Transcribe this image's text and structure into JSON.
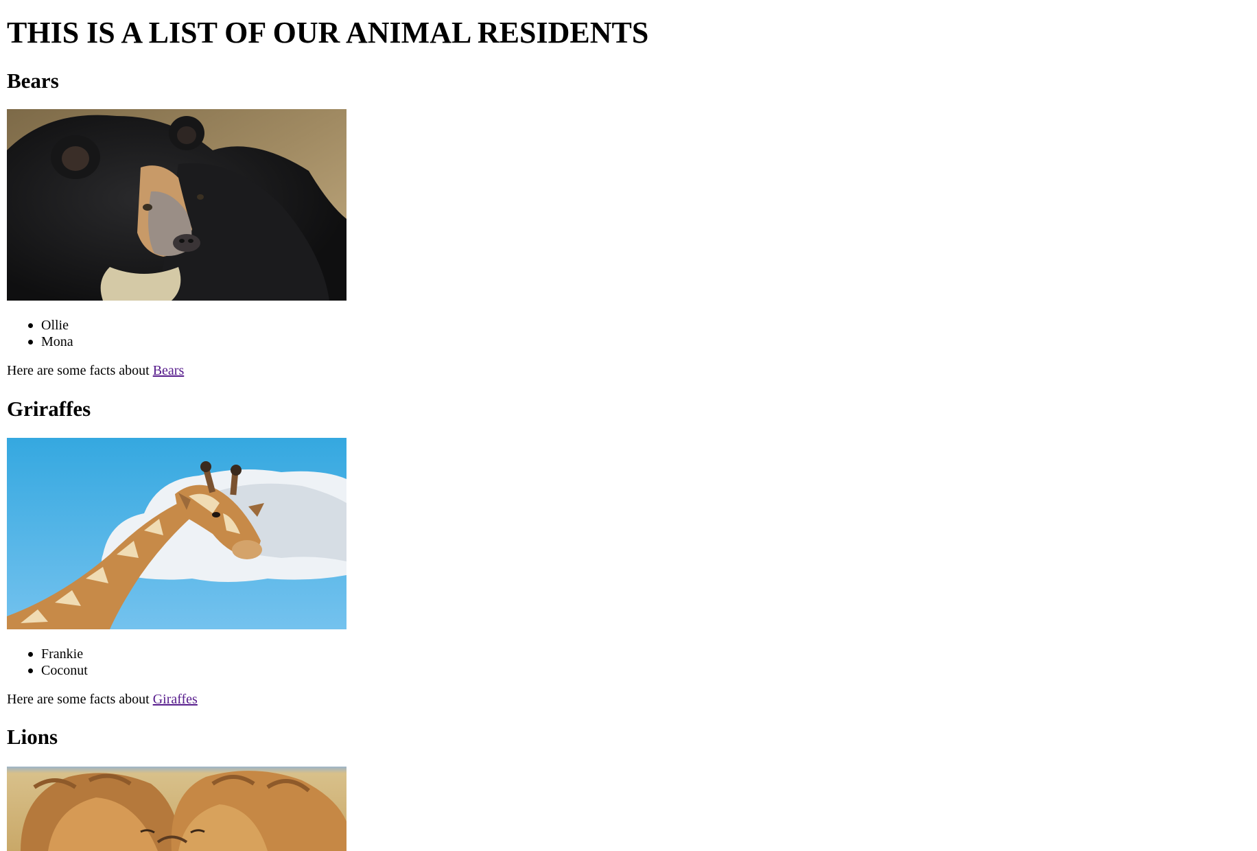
{
  "page": {
    "title": "THIS IS A LIST OF OUR ANIMAL RESIDENTS"
  },
  "sections": [
    {
      "heading": "Bears",
      "image": "bear photo",
      "residents": [
        "Ollie",
        "Mona"
      ],
      "facts_prefix": "Here are some facts about",
      "facts_link": "Bears"
    },
    {
      "heading": "Griraffes",
      "image": "giraffe photo",
      "residents": [
        "Frankie",
        "Coconut"
      ],
      "facts_prefix": "Here are some facts about",
      "facts_link": "Giraffes"
    },
    {
      "heading": "Lions",
      "image": "lions photo"
    }
  ],
  "colors": {
    "visited_link": "#551a8b",
    "text": "#000000",
    "background": "#ffffff"
  }
}
